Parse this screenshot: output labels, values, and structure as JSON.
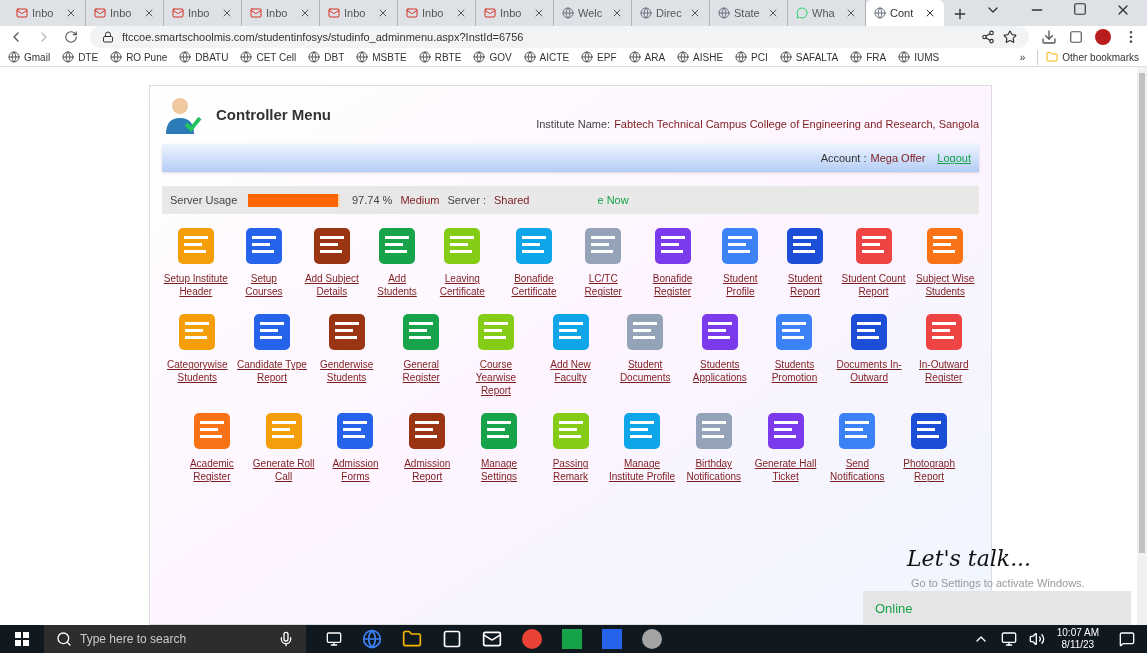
{
  "browser": {
    "tabs": [
      {
        "title": "Inbo",
        "kind": "mail",
        "selected": false
      },
      {
        "title": "Inbo",
        "kind": "mail",
        "selected": false
      },
      {
        "title": "Inbo",
        "kind": "mail",
        "selected": false
      },
      {
        "title": "Inbo",
        "kind": "mail",
        "selected": false
      },
      {
        "title": "Inbo",
        "kind": "mail",
        "selected": false
      },
      {
        "title": "Inbo",
        "kind": "mail",
        "selected": false
      },
      {
        "title": "Inbo",
        "kind": "mail",
        "selected": false
      },
      {
        "title": "Welc",
        "kind": "site",
        "selected": false
      },
      {
        "title": "Direc",
        "kind": "site",
        "selected": false
      },
      {
        "title": "State",
        "kind": "site",
        "selected": false
      },
      {
        "title": "Wha",
        "kind": "chat",
        "selected": false
      },
      {
        "title": "Cont",
        "kind": "site",
        "selected": true
      }
    ],
    "url": "ftccoe.smartschoolmis.com/studentinfosys/studinfo_adminmenu.aspx?InstId=6756",
    "bookmarks": [
      "Gmail",
      "DTE",
      "RO Pune",
      "DBATU",
      "CET Cell",
      "DBT",
      "MSBTE",
      "RBTE",
      "GOV",
      "AICTE",
      "EPF",
      "ARA",
      "AISHE",
      "PCI",
      "SAFALTA",
      "FRA",
      "IUMS"
    ],
    "overflow": "»",
    "other_bookmarks": "Other bookmarks"
  },
  "page": {
    "title": "Controller Menu",
    "institute_label": "Institute Name:",
    "institute_name": "Fabtech Technical Campus College of Engineering and Research, Sangola",
    "account_label": "Account :",
    "account_name": "Mega Offer",
    "logout": "Logout",
    "server": {
      "label": "Server Usage",
      "level": 0.9774,
      "percent": "97.74 %",
      "load": "Medium",
      "server_label": "Server :",
      "server_type": "Shared",
      "marquee": "e Now"
    },
    "menu_rows": [
      [
        "Setup Institute Header",
        "Setup Courses",
        "Add Subject Details",
        "Add Students",
        "Leaving Certificate",
        "Bonafide Certificate",
        "LC/TC Register",
        "Bonafide Register",
        "Student Profile",
        "Student Report",
        "Student Count Report",
        "Subject Wise Students"
      ],
      [
        "Categorywise Students",
        "Candidate Type Report",
        "Genderwise Students",
        "General Register",
        "Course Yearwise Report",
        "Add New Faculty",
        "Student Documents",
        "Students Applications",
        "Students Promotion",
        "Documents In-Outward",
        "In-Outward Register"
      ],
      [
        "Academic Register",
        "Generate Roll Call",
        "Admission Forms",
        "Admission Report",
        "Manage Settings",
        "Passing Remark",
        "Manage Institute Profile",
        "Birthday Notifications",
        "Generate Hall Ticket",
        "Send Notifications",
        "Photograph Report"
      ]
    ],
    "chat": {
      "title": "Let's talk...",
      "status": "Online"
    },
    "os_notice": "Go to Settings to activate Windows."
  },
  "taskbar": {
    "search_placeholder": "Type here to search",
    "time": "10:07 AM",
    "date": "8/11/23"
  }
}
